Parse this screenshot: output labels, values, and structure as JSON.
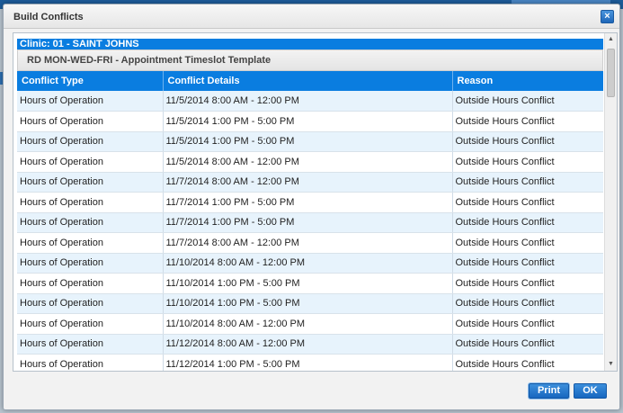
{
  "dialog": {
    "title": "Build Conflicts",
    "close_label": "×"
  },
  "clinic": {
    "label": "Clinic: 01 - SAINT JOHNS"
  },
  "template": {
    "label": "RD MON-WED-FRI - Appointment Timeslot Template"
  },
  "grid": {
    "columns": [
      "Conflict Type",
      "Conflict Details",
      "Reason"
    ],
    "rows": [
      [
        "Hours of Operation",
        "11/5/2014 8:00 AM - 12:00 PM",
        "Outside Hours Conflict"
      ],
      [
        "Hours of Operation",
        "11/5/2014 1:00 PM - 5:00 PM",
        "Outside Hours Conflict"
      ],
      [
        "Hours of Operation",
        "11/5/2014 1:00 PM - 5:00 PM",
        "Outside Hours Conflict"
      ],
      [
        "Hours of Operation",
        "11/5/2014 8:00 AM - 12:00 PM",
        "Outside Hours Conflict"
      ],
      [
        "Hours of Operation",
        "11/7/2014 8:00 AM - 12:00 PM",
        "Outside Hours Conflict"
      ],
      [
        "Hours of Operation",
        "11/7/2014 1:00 PM - 5:00 PM",
        "Outside Hours Conflict"
      ],
      [
        "Hours of Operation",
        "11/7/2014 1:00 PM - 5:00 PM",
        "Outside Hours Conflict"
      ],
      [
        "Hours of Operation",
        "11/7/2014 8:00 AM - 12:00 PM",
        "Outside Hours Conflict"
      ],
      [
        "Hours of Operation",
        "11/10/2014 8:00 AM - 12:00 PM",
        "Outside Hours Conflict"
      ],
      [
        "Hours of Operation",
        "11/10/2014 1:00 PM - 5:00 PM",
        "Outside Hours Conflict"
      ],
      [
        "Hours of Operation",
        "11/10/2014 1:00 PM - 5:00 PM",
        "Outside Hours Conflict"
      ],
      [
        "Hours of Operation",
        "11/10/2014 8:00 AM - 12:00 PM",
        "Outside Hours Conflict"
      ],
      [
        "Hours of Operation",
        "11/12/2014 8:00 AM - 12:00 PM",
        "Outside Hours Conflict"
      ],
      [
        "Hours of Operation",
        "11/12/2014 1:00 PM - 5:00 PM",
        "Outside Hours Conflict"
      ]
    ]
  },
  "footer": {
    "print_label": "Print",
    "ok_label": "OK"
  },
  "colors": {
    "accent": "#0a7de0",
    "row_alt": "#e7f3fc"
  }
}
